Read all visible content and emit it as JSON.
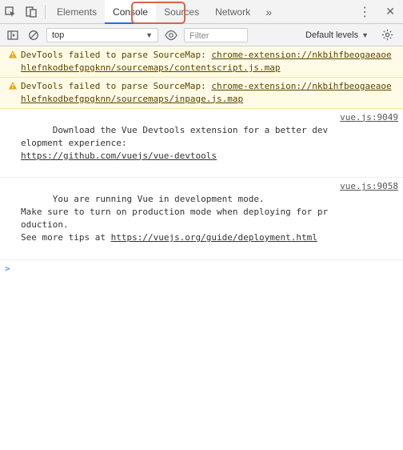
{
  "tabs": {
    "items": [
      "Elements",
      "Console",
      "Sources",
      "Network"
    ],
    "active_index": 1
  },
  "toolbar": {
    "context": "top",
    "filter_placeholder": "Filter",
    "levels_label": "Default levels"
  },
  "annotation": {
    "highlighted_tab": "Console"
  },
  "messages": [
    {
      "type": "warn",
      "text_prefix": "DevTools failed to parse SourceMap: ",
      "link": "chrome-extension://nkbihfbeogaeaoehlefnkodbefgpgknn/sourcemaps/contentscript.js.map",
      "source": ""
    },
    {
      "type": "warn",
      "text_prefix": "DevTools failed to parse SourceMap: ",
      "link": "chrome-extension://nkbihfbeogaeaoehlefnkodbefgpgknn/sourcemaps/inpage.js.map",
      "source": ""
    },
    {
      "type": "log",
      "text_prefix": "Download the Vue Devtools extension for a better development experience:\n",
      "link": "https://github.com/vuejs/vue-devtools",
      "source": "vue.js:9049"
    },
    {
      "type": "log",
      "text_prefix": "You are running Vue in development mode.\nMake sure to turn on production mode when deploying for production.\nSee more tips at ",
      "link": "https://vuejs.org/guide/deployment.html",
      "source": "vue.js:9058"
    }
  ],
  "prompt": {
    "symbol": ">"
  }
}
